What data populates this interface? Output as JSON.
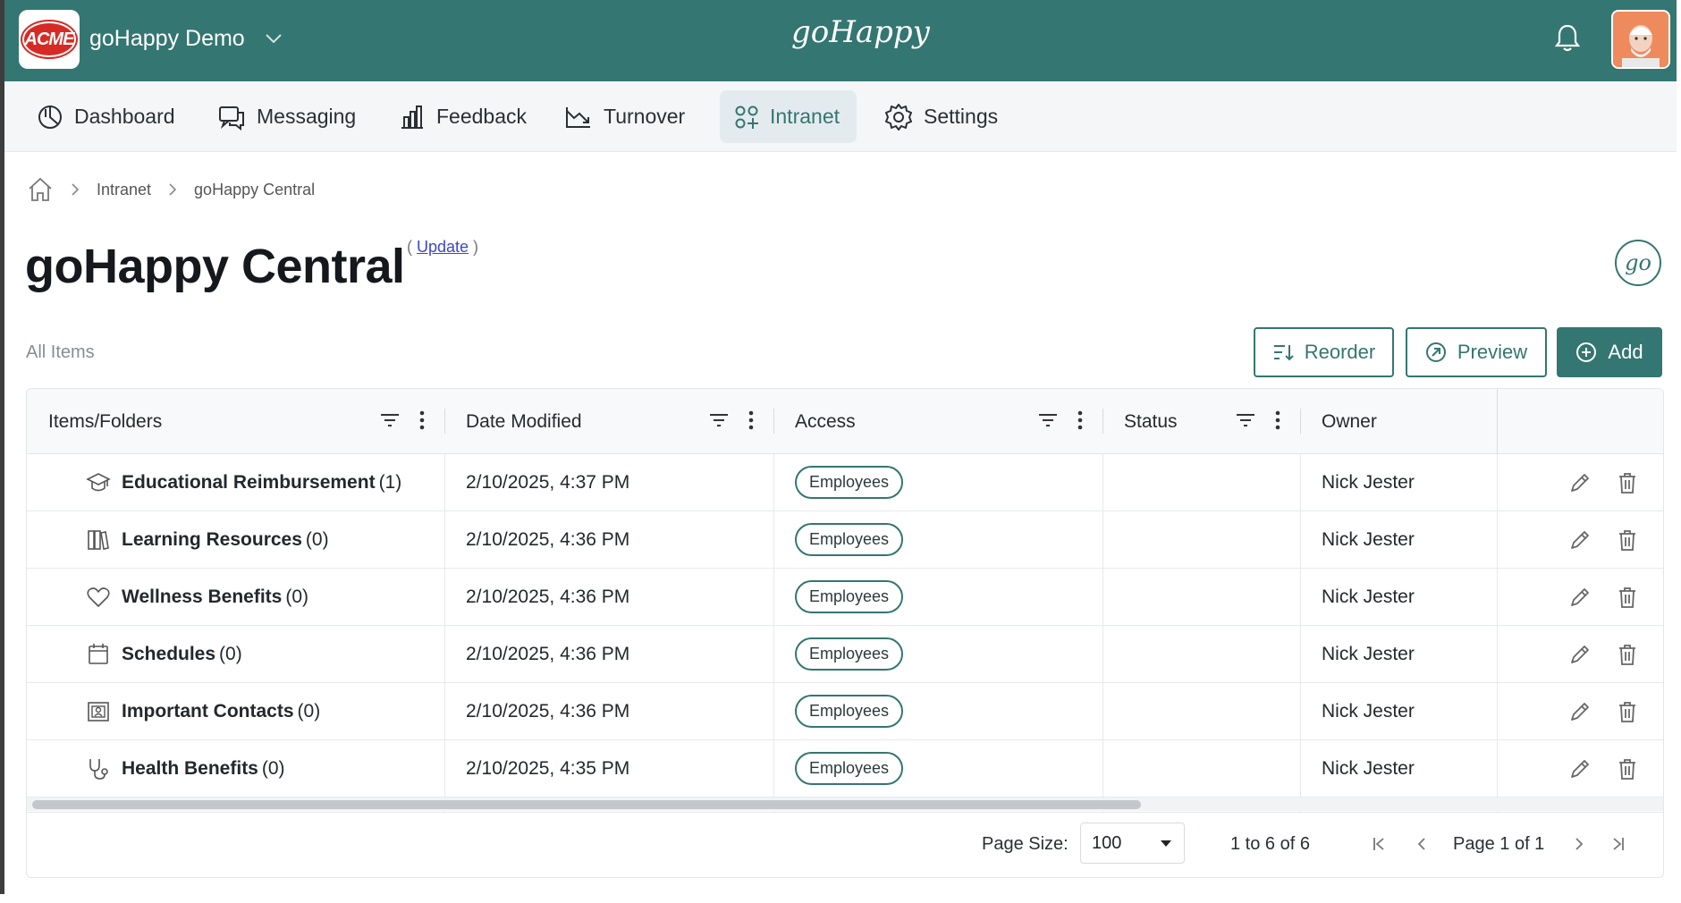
{
  "header": {
    "org_logo_text": "ACME",
    "org_name": "goHappy Demo",
    "brand": "goHappy"
  },
  "nav": {
    "items": [
      {
        "label": "Dashboard",
        "icon": "pie-chart-icon"
      },
      {
        "label": "Messaging",
        "icon": "chat-bubbles-icon"
      },
      {
        "label": "Feedback",
        "icon": "bar-chart-icon"
      },
      {
        "label": "Turnover",
        "icon": "trend-down-icon"
      },
      {
        "label": "Intranet",
        "icon": "grid-plus-icon",
        "active": true
      },
      {
        "label": "Settings",
        "icon": "gear-icon"
      }
    ]
  },
  "breadcrumb": {
    "home_icon": "home-icon",
    "items": [
      "Intranet",
      "goHappy Central"
    ]
  },
  "page": {
    "title": "goHappy Central",
    "update_label": "Update",
    "badge_text": "go",
    "all_items_label": "All Items"
  },
  "toolbar": {
    "reorder_label": "Reorder",
    "preview_label": "Preview",
    "add_label": "Add"
  },
  "table": {
    "columns": [
      "Items/Folders",
      "Date Modified",
      "Access",
      "Status",
      "Owner"
    ],
    "rows": [
      {
        "icon": "graduation-icon",
        "name": "Educational Reimbursement",
        "count": "(1)",
        "date": "2/10/2025, 4:37 PM",
        "access": "Employees",
        "status": "",
        "owner": "Nick Jester"
      },
      {
        "icon": "books-icon",
        "name": "Learning Resources",
        "count": "(0)",
        "date": "2/10/2025, 4:36 PM",
        "access": "Employees",
        "status": "",
        "owner": "Nick Jester"
      },
      {
        "icon": "heart-icon",
        "name": "Wellness Benefits",
        "count": "(0)",
        "date": "2/10/2025, 4:36 PM",
        "access": "Employees",
        "status": "",
        "owner": "Nick Jester"
      },
      {
        "icon": "calendar-icon",
        "name": "Schedules",
        "count": "(0)",
        "date": "2/10/2025, 4:36 PM",
        "access": "Employees",
        "status": "",
        "owner": "Nick Jester"
      },
      {
        "icon": "contacts-icon",
        "name": "Important Contacts",
        "count": "(0)",
        "date": "2/10/2025, 4:36 PM",
        "access": "Employees",
        "status": "",
        "owner": "Nick Jester"
      },
      {
        "icon": "stethoscope-icon",
        "name": "Health Benefits",
        "count": "(0)",
        "date": "2/10/2025, 4:35 PM",
        "access": "Employees",
        "status": "",
        "owner": "Nick Jester"
      }
    ]
  },
  "pagination": {
    "page_size_label": "Page Size:",
    "page_size": "100",
    "range": "1 to 6 of 6",
    "page_text": "Page 1 of 1"
  },
  "colors": {
    "brand": "#347671",
    "acme_red": "#d62b24"
  }
}
